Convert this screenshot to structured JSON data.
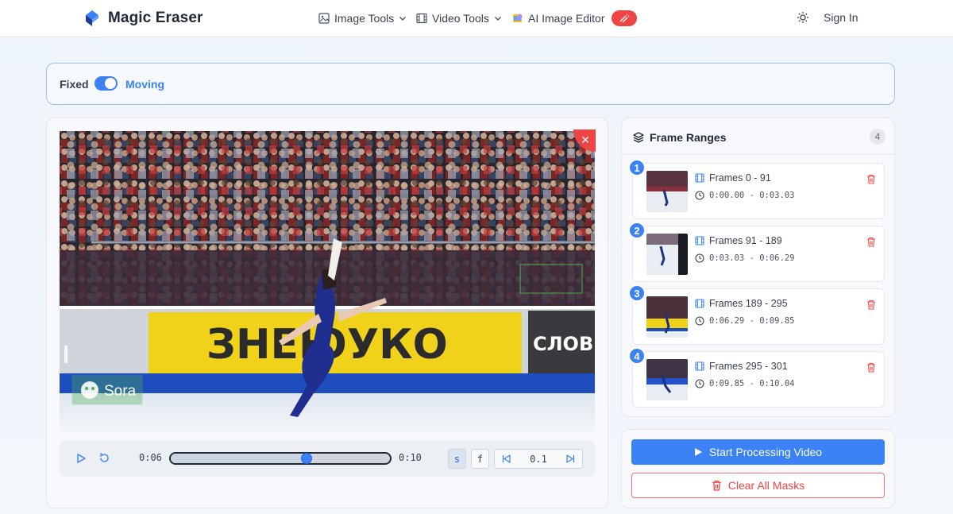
{
  "header": {
    "logo_text": "Magic Eraser",
    "nav": [
      {
        "label": "Image Tools",
        "icon": "image-icon"
      },
      {
        "label": "Video Tools",
        "icon": "film-icon"
      },
      {
        "label": "AI Image Editor",
        "icon": "paint-icon"
      }
    ],
    "sign_in": "Sign In"
  },
  "mode": {
    "fixed_label": "Fixed",
    "moving_label": "Moving",
    "toggle_on": true
  },
  "video": {
    "watermark_text": "Sora",
    "billboard_text": "ЗНЕЮУКО",
    "billboard_side": "СЛОВ"
  },
  "player": {
    "current_time": "0:06",
    "total_time": "0:10",
    "progress_fraction": 0.62,
    "key_s": "s",
    "key_f": "f",
    "step_value": "0.1"
  },
  "ranges": {
    "title": "Frame Ranges",
    "count": "4",
    "items": [
      {
        "num": "1",
        "frames": "Frames 0 - 91",
        "time": "0:00.00 - 0:03.03"
      },
      {
        "num": "2",
        "frames": "Frames 91 - 189",
        "time": "0:03.03 - 0:06.29"
      },
      {
        "num": "3",
        "frames": "Frames 189 - 295",
        "time": "0:06.29 - 0:09.85"
      },
      {
        "num": "4",
        "frames": "Frames 295 - 301",
        "time": "0:09.85 - 0:10.04"
      }
    ]
  },
  "actions": {
    "start_label": "Start Processing Video",
    "clear_label": "Clear All Masks"
  },
  "colors": {
    "accent": "#3b82f6",
    "danger": "#ef4444"
  }
}
